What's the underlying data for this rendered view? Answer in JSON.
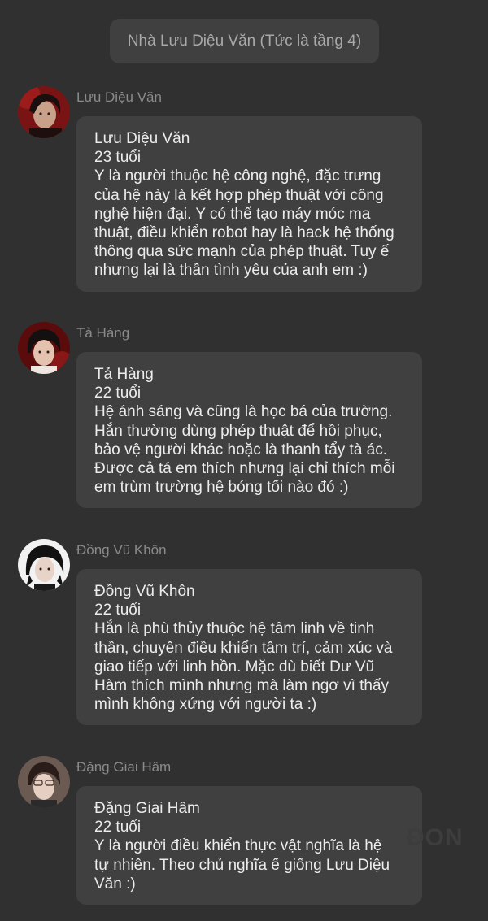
{
  "room": {
    "title": "Nhà Lưu Diệu Văn (Tức là tầng 4)"
  },
  "messages": [
    {
      "sender": "Lưu Diệu Văn",
      "name": "Lưu Diệu Văn",
      "age": "23 tuổi",
      "lines": [
        "Y là người thuộc hệ công nghệ, đặc trưng",
        "của hệ này là kết hợp phép thuật với công",
        "nghệ hiện đại. Y có thể tạo máy móc ma",
        "thuật, điều khiển robot hay là hack hệ thống",
        "thông qua sức mạnh của phép thuật. Tuy ế",
        "nhưng lại là thần tình yêu của anh em :)"
      ]
    },
    {
      "sender": "Tả Hàng",
      "name": "Tả Hàng",
      "age": "22 tuổi",
      "lines": [
        "Hệ ánh sáng và cũng là học bá của trường.",
        "Hắn thường dùng phép thuật để hồi phục,",
        "bảo vệ người khác hoặc là thanh tẩy tà ác.",
        "Được cả tá em thích nhưng lại chỉ thích mỗi",
        "em trùm trường hệ bóng tối nào đó :)"
      ]
    },
    {
      "sender": "Đồng Vũ Khôn",
      "name": "Đồng Vũ Khôn",
      "age": "22 tuổi",
      "lines": [
        "Hắn là phù thủy thuộc hệ tâm linh về tinh",
        "thần, chuyên điều khiển tâm trí, cảm xúc và",
        "giao tiếp với linh hồn. Mặc dù biết Dư Vũ",
        "Hàm thích mình nhưng mà làm ngơ vì thấy",
        "mình không xứng với người ta :)"
      ]
    },
    {
      "sender": "Đặng Giai Hâm",
      "name": "Đặng Giai Hâm",
      "age": "22 tuổi",
      "lines": [
        "Y là người điều khiển thực vật nghĩa là hệ",
        "tự nhiên. Theo chủ nghĩa ế giống Lưu Diệu",
        "Văn :)"
      ]
    }
  ],
  "watermark": "ĐON"
}
